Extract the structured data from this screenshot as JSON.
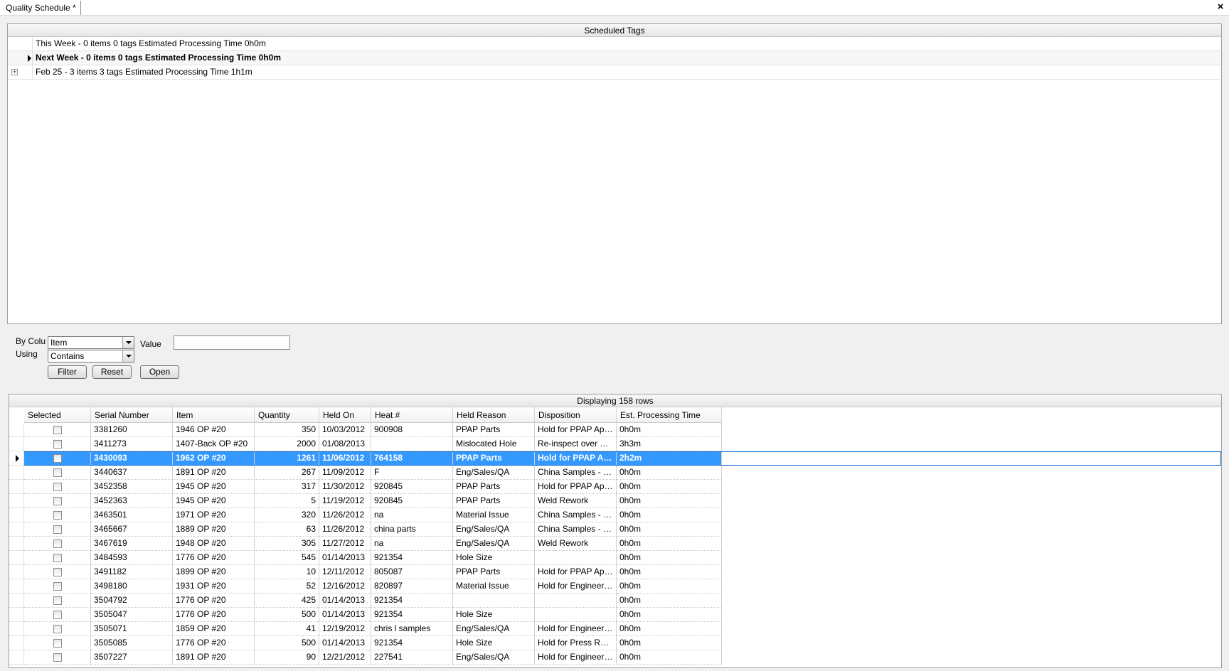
{
  "tab": {
    "title": "Quality Schedule *",
    "close": "×"
  },
  "scheduled": {
    "caption": "Scheduled Tags",
    "groups": [
      {
        "label": "This Week - 0 items 0 tags  Estimated Processing Time 0h0m"
      },
      {
        "label": "Next Week - 0 items 0 tags  Estimated Processing Time 0h0m"
      },
      {
        "label": "Feb 25 - 3 items 3 tags  Estimated Processing Time 1h1m"
      }
    ]
  },
  "filter": {
    "by_column_label": "By Colu",
    "using_label": "Using",
    "column_value": "Item",
    "using_value": "Contains",
    "value_label": "Value",
    "value_text": "",
    "filter_btn": "Filter",
    "reset_btn": "Reset",
    "open_btn": "Open"
  },
  "grid": {
    "caption": "Displaying 158 rows",
    "columns": [
      "Selected",
      "Serial Number",
      "Item",
      "Quantity",
      "Held On",
      "Heat #",
      "Held Reason",
      "Disposition",
      "Est. Processing Time"
    ],
    "selected_row_index": 2,
    "rows": [
      [
        "3381260",
        "1946 OP #20",
        "350",
        "10/03/2012",
        "900908",
        "PPAP Parts",
        "Hold for  PPAP Appr...",
        "0h0m"
      ],
      [
        "3411273",
        "1407-Back OP #20",
        "2000",
        "01/08/2013",
        "",
        "Mislocated Hole",
        "Re-inspect over gau...",
        "3h3m"
      ],
      [
        "3430093",
        "1962 OP #20",
        "1261",
        "11/06/2012",
        "764158",
        "PPAP Parts",
        "Hold for PPAP App...",
        "2h2m"
      ],
      [
        "3440637",
        "1891 OP #20",
        "267",
        "11/09/2012",
        "F",
        "Eng/Sales/QA",
        "China Samples - H...",
        "0h0m"
      ],
      [
        "3452358",
        "1945 OP #20",
        "317",
        "11/30/2012",
        "920845",
        "PPAP Parts",
        "Hold for  PPAP Appr...",
        "0h0m"
      ],
      [
        "3452363",
        "1945 OP #20",
        "5",
        "11/19/2012",
        "920845",
        "PPAP Parts",
        "Weld Rework",
        "0h0m"
      ],
      [
        "3463501",
        "1971 OP #20",
        "320",
        "11/26/2012",
        "na",
        "Material Issue",
        "China Samples - H...",
        "0h0m"
      ],
      [
        "3465667",
        "1889 OP #20",
        "63",
        "11/26/2012",
        "china parts",
        "Eng/Sales/QA",
        "China Samples - H...",
        "0h0m"
      ],
      [
        "3467619",
        "1948 OP #20",
        "305",
        "11/27/2012",
        "na",
        "Eng/Sales/QA",
        "Weld Rework",
        "0h0m"
      ],
      [
        "3484593",
        "1776 OP #20",
        "545",
        "01/14/2013",
        "921354",
        "Hole Size",
        "",
        "0h0m"
      ],
      [
        "3491182",
        "1899 OP #20",
        "10",
        "12/11/2012",
        "805087",
        "PPAP Parts",
        "Hold for  PPAP Appr...",
        "0h0m"
      ],
      [
        "3498180",
        "1931 OP #20",
        "52",
        "12/16/2012",
        "820897",
        "Material Issue",
        "Hold for Engineering",
        "0h0m"
      ],
      [
        "3504792",
        "1776 OP #20",
        "425",
        "01/14/2013",
        "921354",
        "",
        "",
        "0h0m"
      ],
      [
        "3505047",
        "1776 OP #20",
        "500",
        "01/14/2013",
        "921354",
        "Hole Size",
        "",
        "0h0m"
      ],
      [
        "3505071",
        "1859 OP #20",
        "41",
        "12/19/2012",
        "chris l samples",
        "Eng/Sales/QA",
        "Hold for Engineering",
        "0h0m"
      ],
      [
        "3505085",
        "1776 OP #20",
        "500",
        "01/14/2013",
        "921354",
        "Hole Size",
        "Hold for Press Re-hit",
        "0h0m"
      ],
      [
        "3507227",
        "1891 OP #20",
        "90",
        "12/21/2012",
        "227541",
        "Eng/Sales/QA",
        "Hold for Engineering",
        "0h0m"
      ]
    ]
  }
}
